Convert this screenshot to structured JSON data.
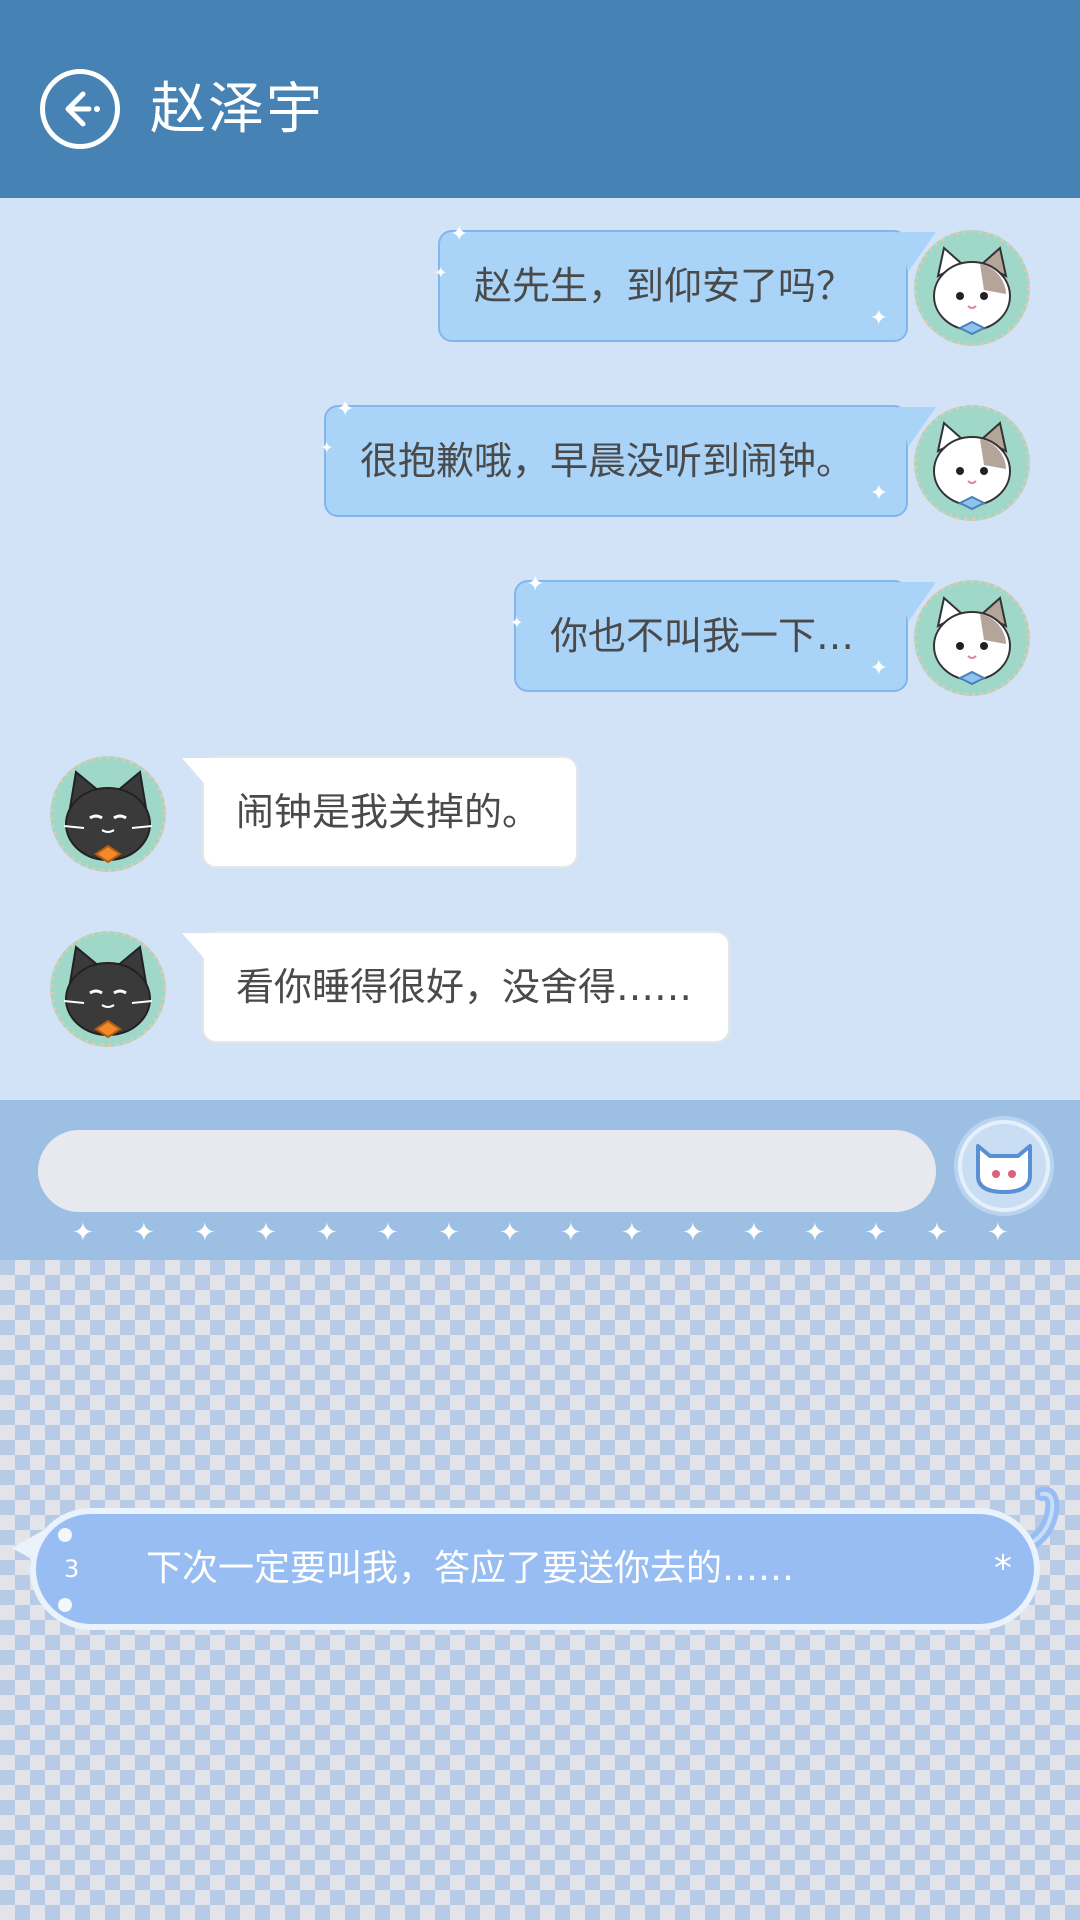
{
  "header": {
    "title": "赵泽宇"
  },
  "messages": [
    {
      "side": "me",
      "text": "赵先生，到仰安了吗？"
    },
    {
      "side": "me",
      "text": "很抱歉哦，早晨没听到闹钟。"
    },
    {
      "side": "me",
      "text": "你也不叫我一下…"
    },
    {
      "side": "them",
      "text": "闹钟是我关掉的。"
    },
    {
      "side": "them",
      "text": "看你睡得很好，没舍得……"
    }
  ],
  "input": {
    "value": "",
    "placeholder": ""
  },
  "suggestion": {
    "number": "3",
    "text": "下次一定要叫我，答应了要送你去的……",
    "mark": "*"
  },
  "colors": {
    "header": "#4682b4",
    "chat_background": "#d3e3f7",
    "my_bubble": "#a9d3f7",
    "their_bubble": "#ffffff",
    "suggestion_bubble": "#97bdf2"
  },
  "icons": {
    "back": "back-arrow-icon",
    "my_avatar": "white-cat-avatar",
    "their_avatar": "black-cat-avatar",
    "send": "cat-face-icon"
  }
}
